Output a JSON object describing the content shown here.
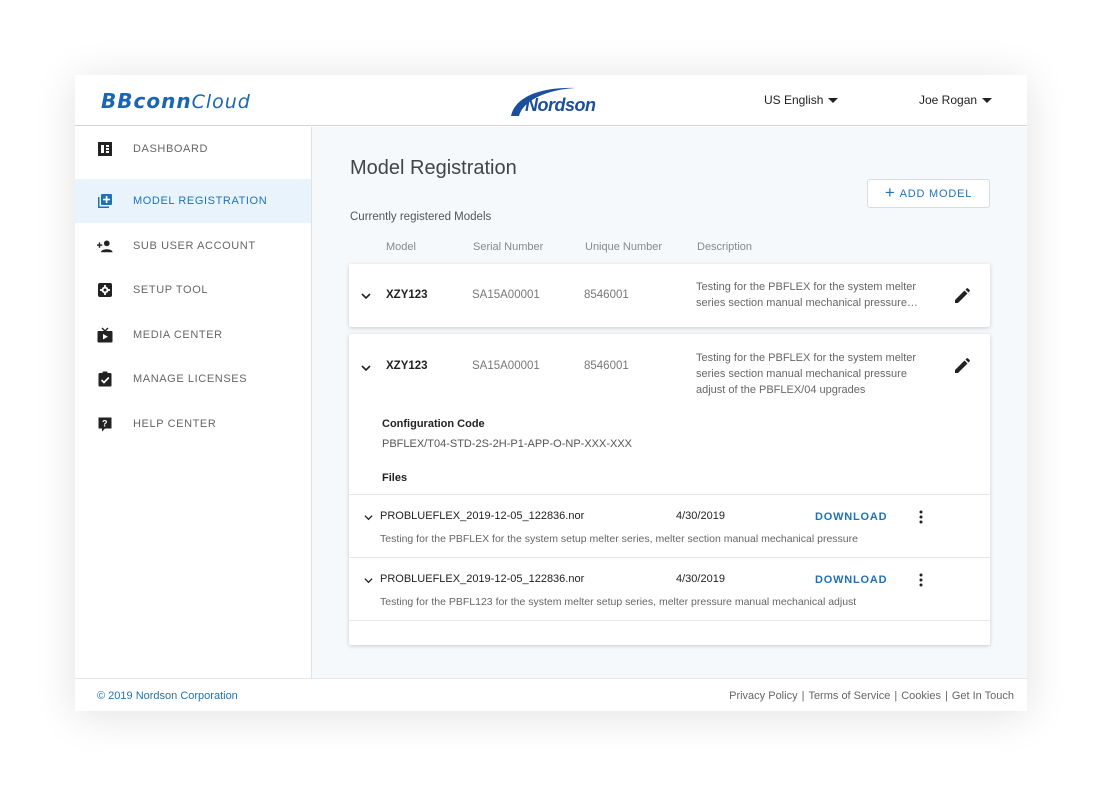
{
  "header": {
    "app_name_bold": "BBconn",
    "app_name_light": "Cloud",
    "brand": "Nordson",
    "language": "US English",
    "user": "Joe Rogan"
  },
  "sidebar": {
    "items": [
      {
        "label": "DASHBOARD",
        "icon": "dashboard-icon",
        "active": false
      },
      {
        "label": "MODEL REGISTRATION",
        "icon": "library-add-icon",
        "active": true
      },
      {
        "label": "SUB USER ACCOUNT",
        "icon": "person-add-icon",
        "active": false
      },
      {
        "label": "SETUP TOOL",
        "icon": "settings-box-icon",
        "active": false
      },
      {
        "label": "MEDIA CENTER",
        "icon": "live-tv-icon",
        "active": false
      },
      {
        "label": "MANAGE LICENSES",
        "icon": "assignment-check-icon",
        "active": false
      },
      {
        "label": "HELP CENTER",
        "icon": "help-icon",
        "active": false
      }
    ]
  },
  "main": {
    "title": "Model Registration",
    "add_button": "ADD MODEL",
    "subtitle": "Currently registered Models",
    "columns": [
      "Model",
      "Serial Number",
      "Unique Number",
      "Description"
    ],
    "models": [
      {
        "model": "XZY123",
        "serial": "SA15A00001",
        "unique": "8546001",
        "description_lines": [
          "Testing for the PBFLEX for the system melter",
          "series section manual mechanical pressure…"
        ],
        "expanded": false
      },
      {
        "model": "XZY123",
        "serial": "SA15A00001",
        "unique": "8546001",
        "description_lines": [
          "Testing for the PBFLEX for the system melter",
          "series section manual mechanical pressure",
          "adjust of the PBFLEX/04 upgrades"
        ],
        "expanded": true,
        "config_label": "Configuration Code",
        "config_value": "PBFLEX/T04-STD-2S-2H-P1-APP-O-NP-XXX-XXX",
        "files_label": "Files",
        "files": [
          {
            "name": "PROBLUEFLEX_2019-12-05_122836.nor",
            "date": "4/30/2019",
            "action": "DOWNLOAD",
            "description": "Testing for the PBFLEX for the system setup melter series, melter section manual mechanical pressure"
          },
          {
            "name": "PROBLUEFLEX_2019-12-05_122836.nor",
            "date": "4/30/2019",
            "action": "DOWNLOAD",
            "description": "Testing for the PBFL123 for the system melter setup series, melter pressure manual mechanical adjust"
          }
        ]
      }
    ]
  },
  "footer": {
    "copyright": "© 2019 Nordson Corporation",
    "links": [
      "Privacy Policy",
      "Terms of Service",
      "Cookies",
      "Get In Touch"
    ]
  },
  "colors": {
    "accent": "#1f72b8",
    "active_bg": "#e9f3fb",
    "main_bg": "#f5f9fc"
  }
}
